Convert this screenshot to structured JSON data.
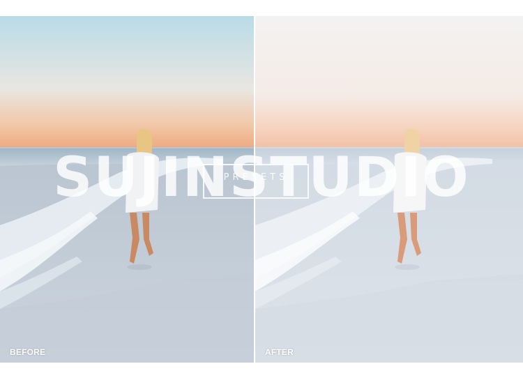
{
  "watermark": {
    "brand": "SUJINSTUDIO",
    "subtitle": "PRESETS"
  },
  "panels": {
    "before": {
      "label": "BEFORE"
    },
    "after": {
      "label": "AFTER"
    }
  },
  "colors": {
    "before_sky_top": "#bcdce6",
    "before_sky_bottom": "#f4b892",
    "after_sky_top": "#f4f2f2",
    "after_sky_bottom": "#f6c8ad",
    "sand": "#c9d3dd",
    "foam": "#f2f6fa"
  }
}
